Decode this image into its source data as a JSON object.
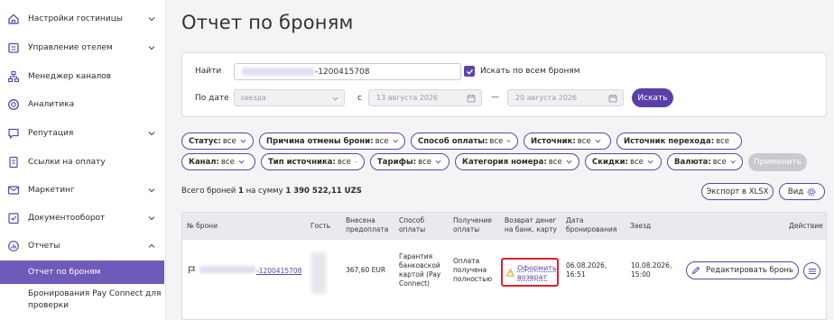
{
  "sidebar": {
    "items": [
      {
        "label": "Настройки гостиницы",
        "icon": "home-icon",
        "chevron": true
      },
      {
        "label": "Управление отелем",
        "icon": "hotel-icon",
        "chevron": true
      },
      {
        "label": "Менеджер каналов",
        "icon": "channels-icon",
        "chevron": false
      },
      {
        "label": "Аналитика",
        "icon": "analytics-icon",
        "chevron": false
      },
      {
        "label": "Репутация",
        "icon": "chat-icon",
        "chevron": true
      },
      {
        "label": "Ссылки на оплату",
        "icon": "payment-link-icon",
        "chevron": false
      },
      {
        "label": "Маркетинг",
        "icon": "mail-icon",
        "chevron": true
      },
      {
        "label": "Документооборот",
        "icon": "document-icon",
        "chevron": true
      },
      {
        "label": "Отчеты",
        "icon": "reports-icon",
        "chevron": true
      }
    ],
    "sub_active": "Отчет по броням",
    "sub_item": "Бронирования Pay Connect для проверки"
  },
  "page_title": "Отчет по броням",
  "search": {
    "find_label": "Найти",
    "value": "-1200415708",
    "search_all_label": "Искать по всем броням",
    "date_label": "По дате",
    "date_type": "заезда",
    "from_label": "с",
    "date_from": "13 августа 2026",
    "date_to": "20 августа 2026",
    "dash": "—",
    "search_button": "Искать"
  },
  "filters": {
    "row1": [
      {
        "name": "Статус:",
        "value": "все"
      },
      {
        "name": "Причина отмены брони:",
        "value": "все"
      },
      {
        "name": "Способ оплаты:",
        "value": "все"
      },
      {
        "name": "Источник:",
        "value": "все"
      },
      {
        "name": "Источник перехода:",
        "value": "все"
      }
    ],
    "row2": [
      {
        "name": "Канал:",
        "value": "все"
      },
      {
        "name": "Тип источника:",
        "value": "все"
      },
      {
        "name": "Тарифы:",
        "value": "все"
      },
      {
        "name": "Категория номера:",
        "value": "все"
      },
      {
        "name": "Скидки:",
        "value": "все"
      },
      {
        "name": "Валюта:",
        "value": "все"
      }
    ],
    "apply_button": "Применить"
  },
  "summary": {
    "prefix": "Всего броней",
    "count": "1",
    "middle": "на сумму",
    "amount": "1 390 522,11 UZS"
  },
  "toolbar": {
    "export_label": "Экспорт в XLSX",
    "view_label": "Вид"
  },
  "table": {
    "headers": {
      "number": "№ брони",
      "guest": "Гость",
      "prepaid": "Внесена предоплата",
      "payment_method": "Способ оплаты",
      "payment_received": "Получение оплаты",
      "refund": "Возврат денег на банк. карту",
      "booking_date": "Дата бронирования",
      "checkin": "Заезд",
      "action": "Действие"
    },
    "row": {
      "number": "-1200415708",
      "prepaid": "367,60 EUR",
      "payment_method": "Гарантия банковской картой (Pay Connect)",
      "payment_received": "Оплата получена полностью",
      "refund_link": "Оформить возврат",
      "booking_date": "06.08.2026, 16:51",
      "checkin": "10.08.2026, 15:00",
      "edit_button": "Редактировать бронь"
    }
  },
  "colors": {
    "accent": "#5b46a6",
    "active_nav": "#6f5ab9",
    "highlight_border": "#e0202a"
  }
}
